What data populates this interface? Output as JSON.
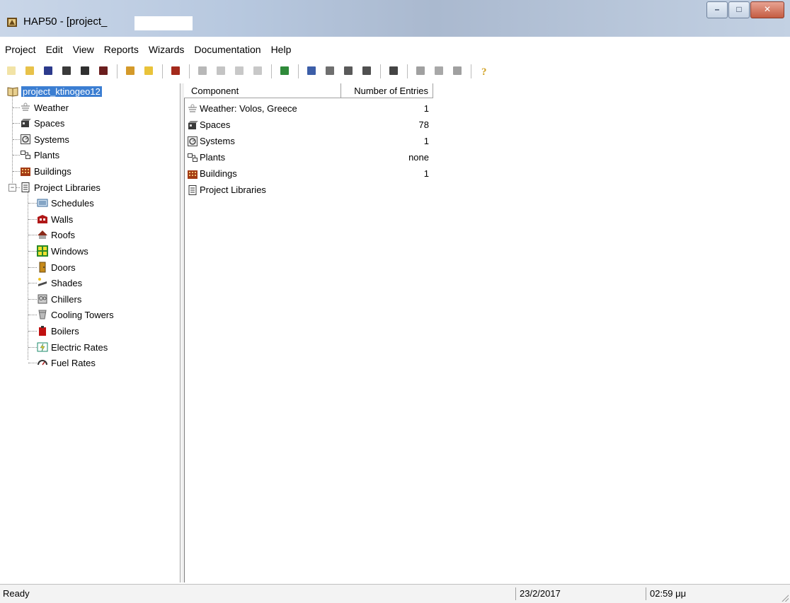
{
  "window": {
    "title": "HAP50 - [project_",
    "controls": {
      "minimize": "–",
      "maximize": "□",
      "close": "✕"
    }
  },
  "menubar": [
    "Project",
    "Edit",
    "View",
    "Reports",
    "Wizards",
    "Documentation",
    "Help"
  ],
  "toolbar": {
    "groups": [
      [
        "new-icon",
        "open-icon",
        "save-icon",
        "library-icon",
        "print-icon",
        "save-as-icon"
      ],
      [
        "edit-icon",
        "folder-icon"
      ],
      [
        "building-icon"
      ],
      [
        "copy-icon",
        "delete-icon",
        "properties-icon",
        "pin-icon"
      ],
      [
        "plant-icon"
      ],
      [
        "large-icons-icon",
        "small-icons-icon",
        "list-icon",
        "details-icon"
      ],
      [
        "calculator-icon"
      ],
      [
        "report-icon",
        "chart-icon",
        "table-icon"
      ],
      [
        "help-icon"
      ]
    ],
    "colors": {
      "new-icon": "#f2e3a6",
      "open-icon": "#e8c24a",
      "save-icon": "#2c3a8c",
      "library-icon": "#3a3a3a",
      "print-icon": "#303030",
      "save-as-icon": "#6b1e1e",
      "edit-icon": "#d49a2a",
      "folder-icon": "#e9c33a",
      "building-icon": "#a42a1c",
      "copy-icon": "#b8b8b8",
      "delete-icon": "#c4c4c4",
      "properties-icon": "#c8c8c8",
      "pin-icon": "#c8c8c8",
      "plant-icon": "#2f8a3a",
      "large-icons-icon": "#3c5ea8",
      "small-icons-icon": "#6f6f6f",
      "list-icon": "#5a5a5a",
      "details-icon": "#505050",
      "calculator-icon": "#444444",
      "report-icon": "#a0a0a0",
      "chart-icon": "#a8a8a8",
      "table-icon": "#a0a0a0",
      "help-icon": "#d0a020"
    }
  },
  "tree": {
    "root": {
      "label": "project_ktinogeo12",
      "icon": "book-icon",
      "color": "#7a5a20"
    },
    "top_items": [
      {
        "label": "Weather",
        "icon": "weather-icon",
        "color": "#9a9a9a"
      },
      {
        "label": "Spaces",
        "icon": "spaces-icon",
        "color": "#3a3a3a"
      },
      {
        "label": "Systems",
        "icon": "systems-icon",
        "color": "#4a4a4a"
      },
      {
        "label": "Plants",
        "icon": "plants-icon",
        "color": "#3a3a3a"
      },
      {
        "label": "Buildings",
        "icon": "buildings-icon",
        "color": "#a33a14"
      },
      {
        "label": "Project Libraries",
        "icon": "libraries-icon",
        "color": "#333333"
      }
    ],
    "library_items": [
      {
        "label": "Schedules",
        "icon": "schedules-icon",
        "color": "#3a6a9a"
      },
      {
        "label": "Walls",
        "icon": "walls-icon",
        "color": "#b01818"
      },
      {
        "label": "Roofs",
        "icon": "roofs-icon",
        "color": "#8a2a1a"
      },
      {
        "label": "Windows",
        "icon": "windows-icon",
        "color": "#2a8a2a"
      },
      {
        "label": "Doors",
        "icon": "doors-icon",
        "color": "#c68a1a"
      },
      {
        "label": "Shades",
        "icon": "shades-icon",
        "color": "#4a4a4a"
      },
      {
        "label": "Chillers",
        "icon": "chillers-icon",
        "color": "#5a5a5a"
      },
      {
        "label": "Cooling Towers",
        "icon": "cooling-towers-icon",
        "color": "#6a6a6a"
      },
      {
        "label": "Boilers",
        "icon": "boilers-icon",
        "color": "#c01010"
      },
      {
        "label": "Electric Rates",
        "icon": "electric-rates-icon",
        "color": "#1a8a6a"
      },
      {
        "label": "Fuel Rates",
        "icon": "fuel-rates-icon",
        "color": "#333333"
      }
    ]
  },
  "listview": {
    "columns": [
      "Component",
      "Number of Entries"
    ],
    "rows": [
      {
        "name": "Weather: Volos, Greece",
        "value": "1",
        "icon": "weather-icon",
        "color": "#9a9a9a"
      },
      {
        "name": "Spaces",
        "value": "78",
        "icon": "spaces-icon",
        "color": "#3a3a3a"
      },
      {
        "name": "Systems",
        "value": "1",
        "icon": "systems-icon",
        "color": "#4a4a4a"
      },
      {
        "name": "Plants",
        "value": "none",
        "icon": "plants-icon",
        "color": "#3a3a3a"
      },
      {
        "name": "Buildings",
        "value": "1",
        "icon": "buildings-icon",
        "color": "#a33a14"
      },
      {
        "name": "Project Libraries",
        "value": "",
        "icon": "libraries-icon",
        "color": "#333333"
      }
    ]
  },
  "statusbar": {
    "message": "Ready",
    "date": "23/2/2017",
    "time": "02:59 μμ"
  },
  "colors": {
    "selection": "#3b7ed2"
  }
}
